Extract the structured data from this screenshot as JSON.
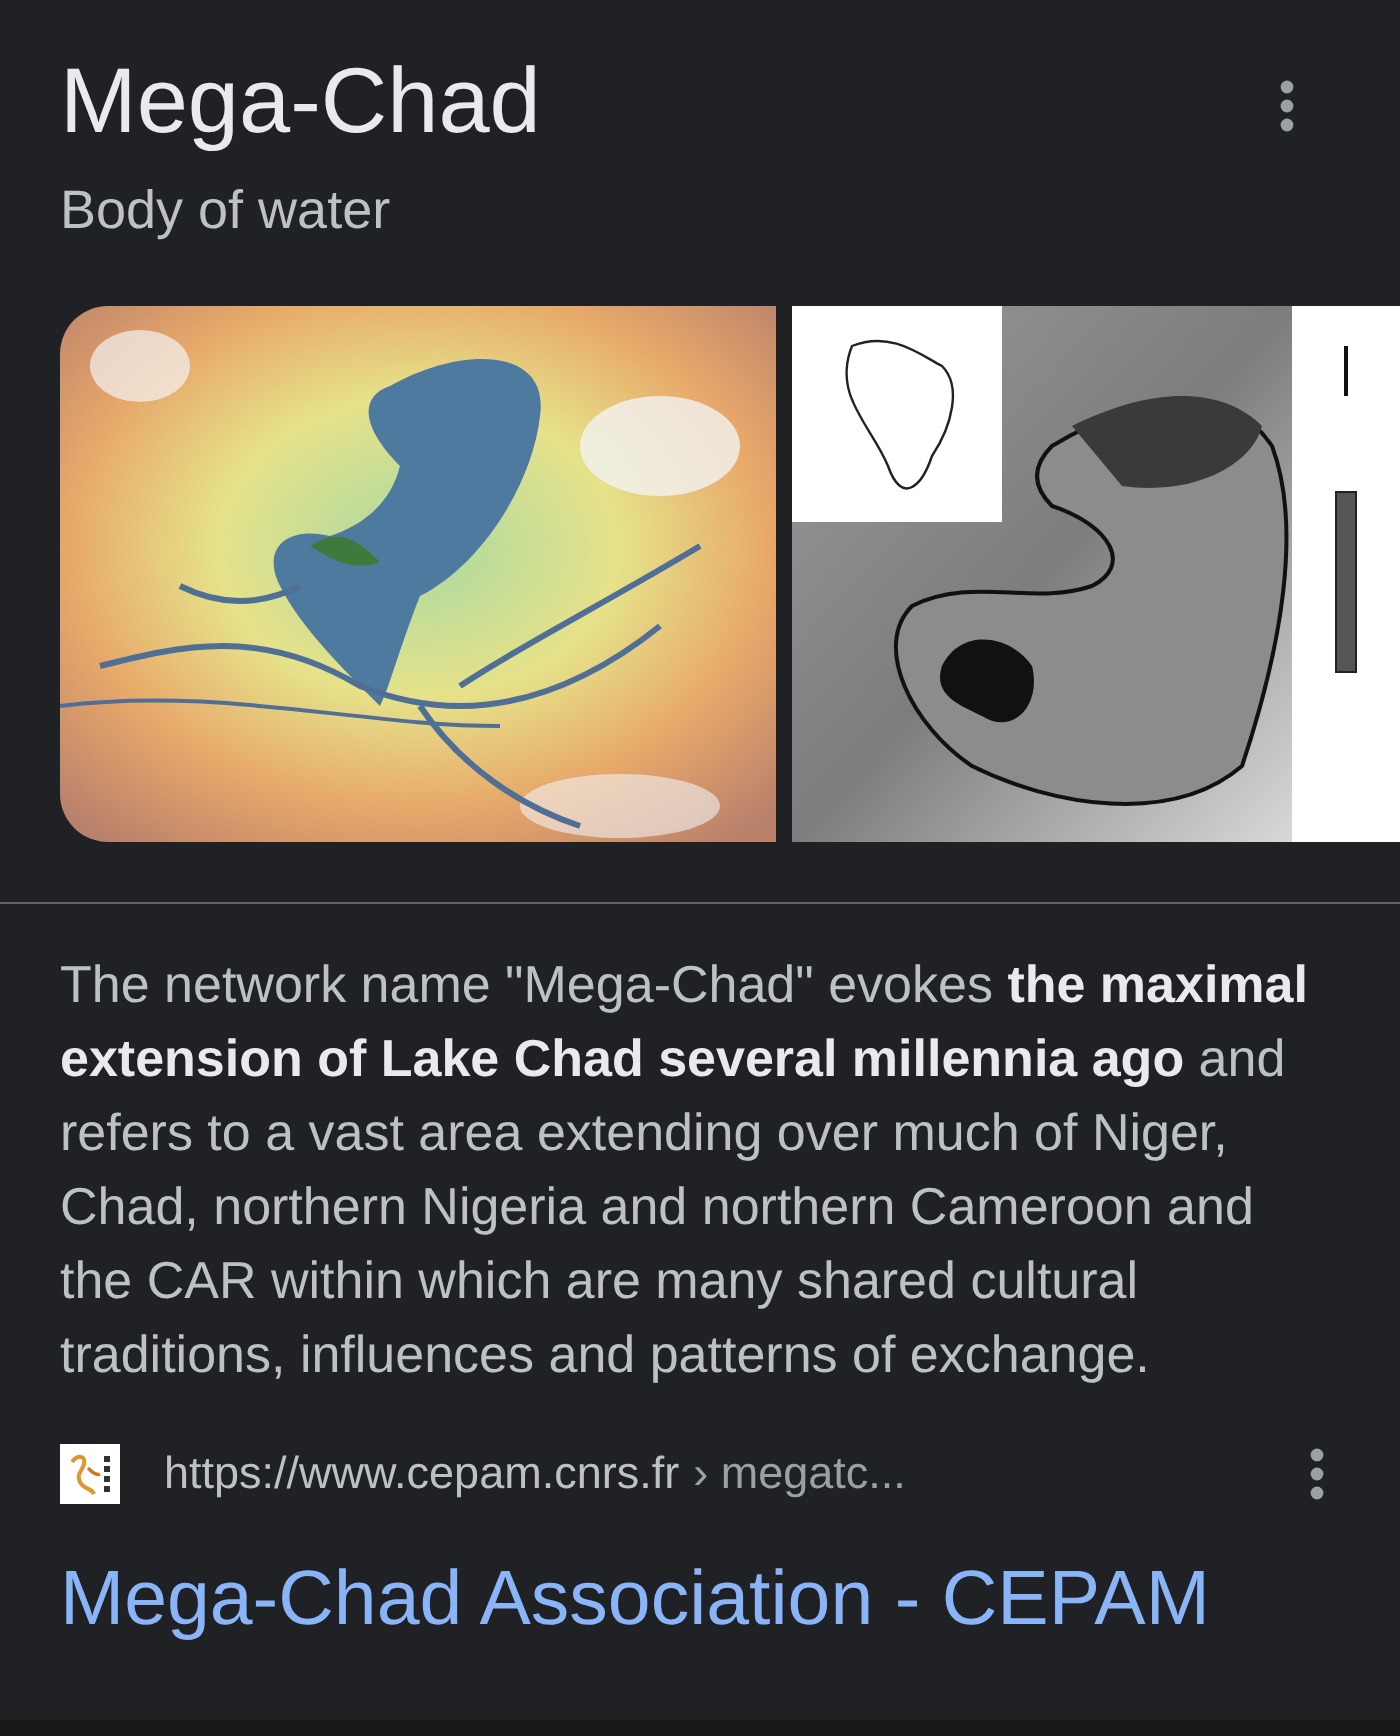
{
  "header": {
    "title": "Mega-Chad",
    "subtitle": "Body of water"
  },
  "images": [
    {
      "kind": "relief_map"
    },
    {
      "kind": "elevation_map"
    }
  ],
  "description": "The network name \"Mega-Chad\" evokes **the maximal extension of Lake Chad several millennia ago** and refers to a vast area extending over much of Niger, Chad, northern Nigeria and northern Cameroon and the CAR within which are many shared cultural traditions, influences and patterns of exchange.",
  "result": {
    "url": "https://www.cepam.cnrs.fr",
    "path": "› megatc...",
    "title": "Mega-Chad Association - CEPAM"
  }
}
